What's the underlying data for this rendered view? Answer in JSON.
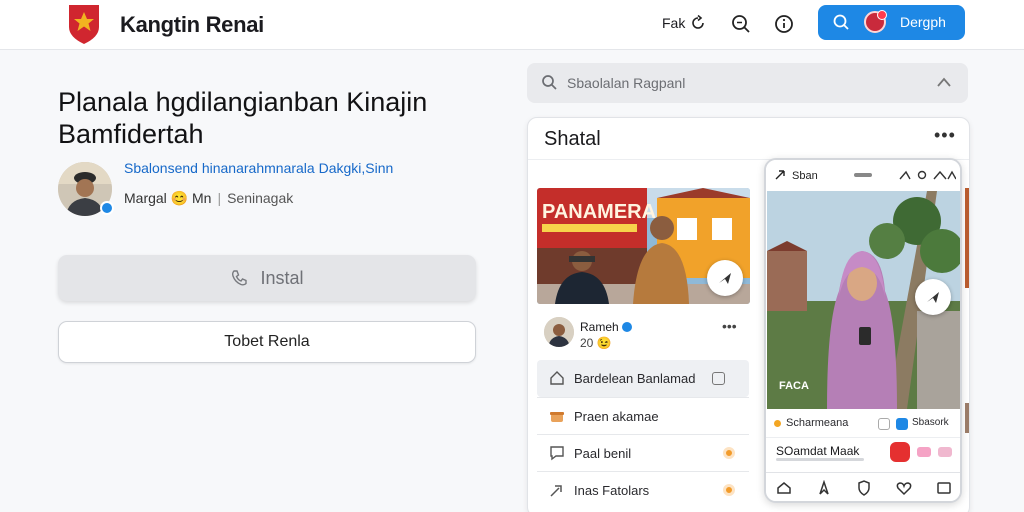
{
  "header": {
    "brand": "Kangtin Renai",
    "nav_link": "Fak",
    "signin_label": "Dergph"
  },
  "colors": {
    "accent": "#1e88e5",
    "logo_red": "#d0262f",
    "logo_gold": "#f2b420",
    "badge_orange": "#f29b2b"
  },
  "main": {
    "headline": "Planala hgdilangianban Kinajin Bamfidertah",
    "author": {
      "link_text": "Sbalonsend hinanarahmnarala Dakgki,Sinn",
      "meta_primary": "Margal 😊 Mn",
      "meta_separator": "|",
      "meta_secondary": "Seninagak"
    },
    "install_label": "Instal",
    "secondary_label": "Tobet Renla"
  },
  "search": {
    "placeholder": "Sbaolalan Ragpanl"
  },
  "card": {
    "title": "Shatal",
    "more": "•••",
    "photo_sign": "PANAMERA",
    "post": {
      "name": "Rameh",
      "count": "20 😉",
      "more": "•••"
    },
    "menu": [
      {
        "label": "Bardelean Banlamad",
        "icon": "home-icon",
        "trailing": "square"
      },
      {
        "label": "Praen akamae",
        "icon": "gift-icon",
        "trailing": ""
      },
      {
        "label": "Paal benil",
        "icon": "chat-icon",
        "trailing": "badge"
      },
      {
        "label": "Inas Fatolars",
        "icon": "share-icon",
        "trailing": "badge"
      }
    ]
  },
  "phone": {
    "status_text": "Sban",
    "strip_label": "Scharmeana",
    "strip_right": "Sbasork",
    "row_label": "SOamdat Maak",
    "photo_caption": "FACA"
  }
}
